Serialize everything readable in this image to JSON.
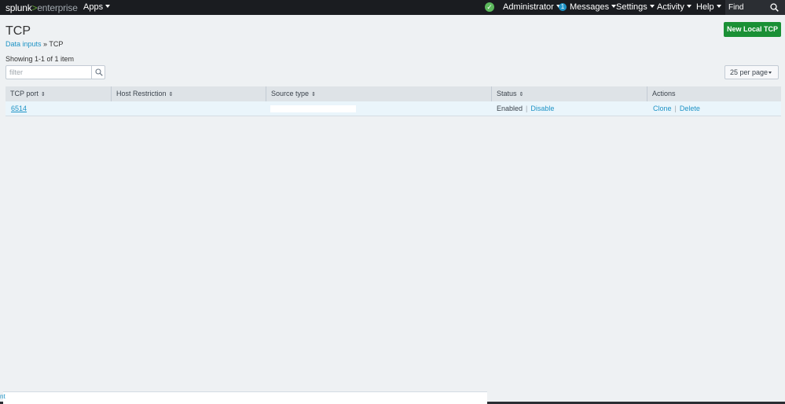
{
  "topbar": {
    "logo_brand": "splunk",
    "logo_gt": ">",
    "logo_product": "enterprise",
    "apps": "Apps",
    "user": "Administrator",
    "messages_count": "1",
    "messages": "Messages",
    "settings": "Settings",
    "activity": "Activity",
    "help": "Help",
    "find_placeholder": "Find",
    "status_color": "#5cb85c"
  },
  "page": {
    "title": "TCP",
    "breadcrumb_parent": "Data inputs",
    "breadcrumb_sep": "»",
    "breadcrumb_current": "TCP",
    "new_button": "New Local TCP",
    "showing": "Showing 1-1 of 1 item",
    "filter_placeholder": "filter",
    "per_page": "25 per page"
  },
  "table": {
    "columns": [
      "TCP port",
      "Host Restriction",
      "Source type",
      "Status",
      "Actions"
    ],
    "rows": [
      {
        "tcp_port": "6514",
        "host_restriction": "",
        "source_type": "",
        "status": "Enabled",
        "status_action": "Disable",
        "action_clone": "Clone",
        "action_delete": "Delete"
      }
    ]
  },
  "bottom": {
    "fragment": "nt"
  },
  "colors": {
    "primary_button": "#1a9035",
    "link": "#1e93c6",
    "topbar": "#1a1c20"
  }
}
